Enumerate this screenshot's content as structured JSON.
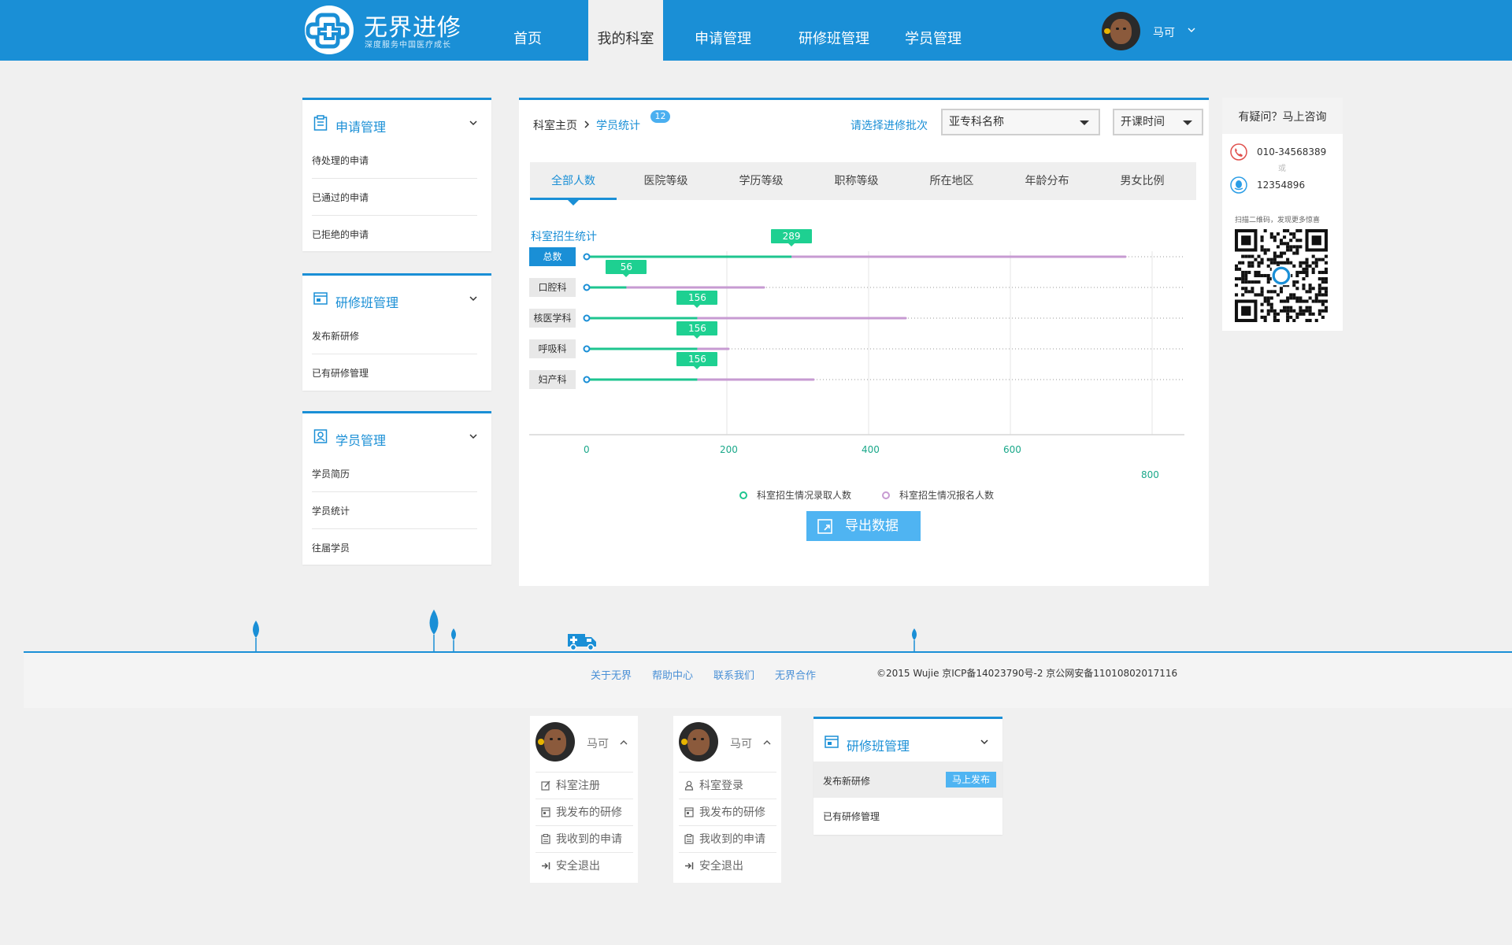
{
  "header": {
    "brand": "无界进修",
    "brand_sub": "深度服务中国医疗成长",
    "nav": [
      "首页",
      "我的科室",
      "申请管理",
      "研修班管理",
      "学员管理"
    ],
    "active_nav": "我的科室",
    "user": "马可"
  },
  "sidebar": {
    "apply": {
      "title": "申请管理",
      "items": [
        "待处理的申请",
        "已通过的申请",
        "已拒绝的申请"
      ]
    },
    "course": {
      "title": "研修班管理",
      "items": [
        "发布新研修",
        "已有研修管理"
      ]
    },
    "students": {
      "title": "学员管理",
      "items": [
        "学员简历",
        "学员统计",
        "往届学员"
      ]
    }
  },
  "main": {
    "breadcrumb_home": "科室主页",
    "breadcrumb_current": "学员统计",
    "badge": "12",
    "batch_label": "请选择进修批次",
    "select_specialty": "亚专科名称",
    "select_time": "开课时间",
    "tabs": [
      "全部人数",
      "医院等级",
      "学历等级",
      "职称等级",
      "所在地区",
      "年龄分布",
      "男女比例"
    ],
    "active_tab": "全部人数",
    "chart_heading": "科室招生统计",
    "export_label": "导出数据"
  },
  "chart_data": {
    "type": "bar",
    "title": "科室招生统计",
    "categories": [
      "总数",
      "口腔科",
      "核医学科",
      "呼吸科",
      "妇产科"
    ],
    "series": [
      {
        "name": "科室招生情况录取人数",
        "color": "#1ec58f",
        "values": [
          289,
          56,
          156,
          156,
          156
        ]
      },
      {
        "name": "科室招生情况报名人数",
        "color": "#c79bd2",
        "values": [
          760,
          250,
          450,
          200,
          320
        ]
      }
    ],
    "badge_values": [
      289,
      56,
      156,
      156,
      156
    ],
    "x_ticks": [
      "0",
      "200",
      "400",
      "600"
    ],
    "x_tick_extra": "800",
    "xlim": [
      0,
      800
    ],
    "grid": true,
    "legend_position": "bottom"
  },
  "consult": {
    "title": "有疑问？马上咨询",
    "phone": "010-34568389",
    "or": "或",
    "qq": "12354896",
    "qr_text": "扫描二维码，发现更多惊喜",
    "phone_color": "#e0504c",
    "qq_color": "#2a9de6"
  },
  "footer": {
    "links": [
      "关于无界",
      "帮助中心",
      "联系我们",
      "无界合作"
    ],
    "copyright": "©2015 Wujie 京ICP备14023790号-2  京公网安备11010802017116"
  },
  "dropdown1": {
    "user": "马可",
    "items": [
      "科室注册",
      "我发布的研修",
      "我收到的申请",
      "安全退出"
    ]
  },
  "dropdown2": {
    "user": "马可",
    "items": [
      "科室登录",
      "我发布的研修",
      "我收到的申请",
      "安全退出"
    ]
  },
  "course_menu": {
    "title": "研修班管理",
    "items": [
      "发布新研修",
      "已有研修管理"
    ],
    "publish": "马上发布"
  }
}
